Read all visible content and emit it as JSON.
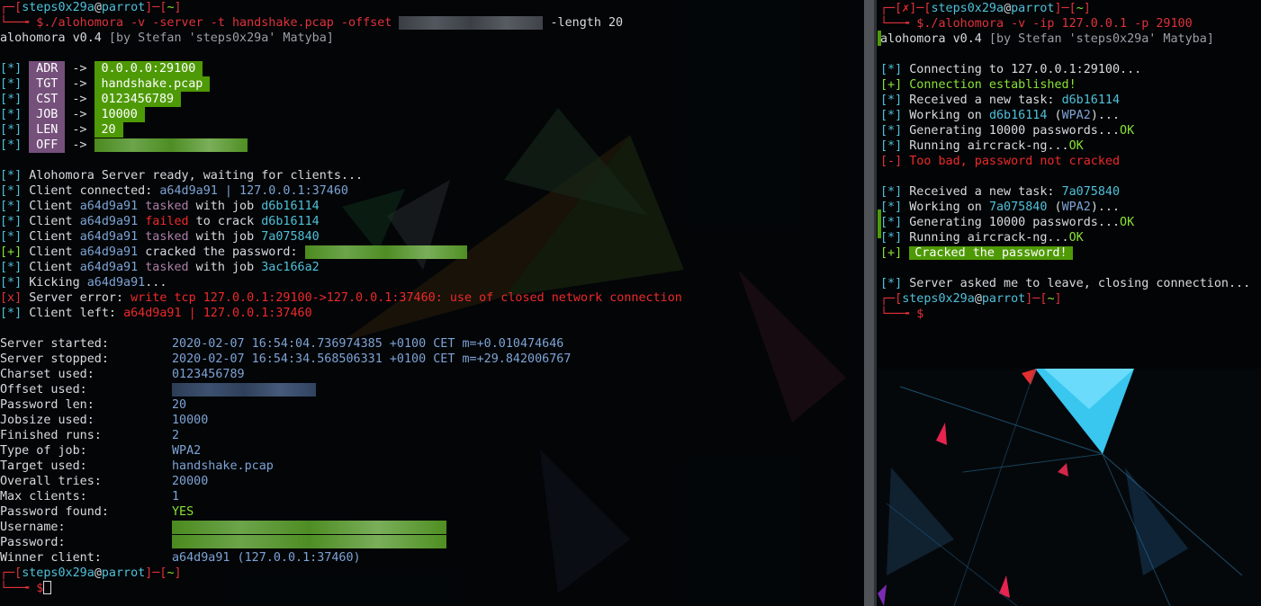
{
  "left": {
    "prompt1": {
      "open": "┌─[",
      "user": "steps0x29a",
      "at": "@",
      "host": "parrot",
      "mid": "]─[",
      "dir": "~",
      "close": "]"
    },
    "cmd1_pre": "└──╼ $./alohomora -v -server -t handshake.pcap -offset ",
    "cmd1_post": " -length 20",
    "banner_name": "alohomora v0.4",
    "banner_by": " [by Stefan 'steps0x29a' Matyba]",
    "params": [
      {
        "tag": "*",
        "label": "ADR",
        "value": "0.0.0.0:29100"
      },
      {
        "tag": "*",
        "label": "TGT",
        "value": "handshake.pcap"
      },
      {
        "tag": "*",
        "label": "CST",
        "value": "0123456789"
      },
      {
        "tag": "*",
        "label": "JOB",
        "value": "10000"
      },
      {
        "tag": "*",
        "label": "LEN",
        "value": "20"
      },
      {
        "tag": "*",
        "label": "OFF",
        "value": ""
      }
    ],
    "arrow": "->",
    "log": {
      "l1": "Alohomora Server ready, waiting for clients...",
      "l2a": "Client connected: ",
      "l2b": "a64d9a91 | 127.0.0.1:37460",
      "client": "Client ",
      "id": "a64d9a91",
      "tasked": "tasked",
      "with_job": " with job ",
      "failed": "failed",
      "to_crack": " to crack ",
      "job1": "d6b16114",
      "job2": "7a075840",
      "job3": "3ac166a2",
      "cracked": " cracked the password: ",
      "kicking": "Kicking ",
      "kick_end": "...",
      "err_a": "Server error: ",
      "err_b": "write tcp 127.0.0.1:29100->127.0.0.1:37460: use of closed network connection",
      "left_a": "Client left: ",
      "left_b": "a64d9a91 | 127.0.0.1:37460"
    },
    "stats": [
      {
        "key": "Server started:",
        "value": "2020-02-07 16:54:04.736974385 +0100 CET m=+0.010474646"
      },
      {
        "key": "Server stopped:",
        "value": "2020-02-07 16:54:34.568506331 +0100 CET m=+29.842006767"
      },
      {
        "key": "Charset used:",
        "value": "0123456789"
      },
      {
        "key": "Offset used:",
        "value": ""
      },
      {
        "key": "Password len:",
        "value": "20"
      },
      {
        "key": "Jobsize used:",
        "value": "10000"
      },
      {
        "key": "Finished runs:",
        "value": "2"
      },
      {
        "key": "Type of job:",
        "value": "WPA2"
      },
      {
        "key": "Target used:",
        "value": "handshake.pcap"
      },
      {
        "key": "Overall tries:",
        "value": "20000"
      },
      {
        "key": "Max clients:",
        "value": "1"
      },
      {
        "key": "Password found:",
        "value": "YES"
      },
      {
        "key": "Username:",
        "value": ""
      },
      {
        "key": "Password:",
        "value": ""
      },
      {
        "key": "Winner client:",
        "value": "a64d9a91 (127.0.0.1:37460)"
      }
    ],
    "prompt_end": "└──╼ $"
  },
  "right": {
    "prompt1": {
      "open": "┌─[",
      "x": "✗",
      "mid1": "]─[",
      "user": "steps0x29a",
      "at": "@",
      "host": "parrot",
      "mid": "]─[",
      "dir": "~",
      "close": "]"
    },
    "cmd": "└──╼ $./alohomora -v -ip 127.0.0.1 -p 29100",
    "banner_name": "alohomora v0.4",
    "banner_by": " [by Stefan 'steps0x29a' Matyba]",
    "connecting": "Connecting to 127.0.0.1:29100...",
    "established": "Connection established!",
    "received": "Received a new task: ",
    "working": "Working on ",
    "wpa": "WPA2",
    "job1": "d6b16114",
    "job2": "7a075840",
    "generating": "Generating 10000 passwords...",
    "ok": "OK",
    "running": "Running aircrack-ng...",
    "toobad": "Too bad, password not cracked",
    "cracked": "Cracked the password!",
    "leave": "Server asked me to leave, closing connection...",
    "prompt_end": "└──╼ $"
  }
}
